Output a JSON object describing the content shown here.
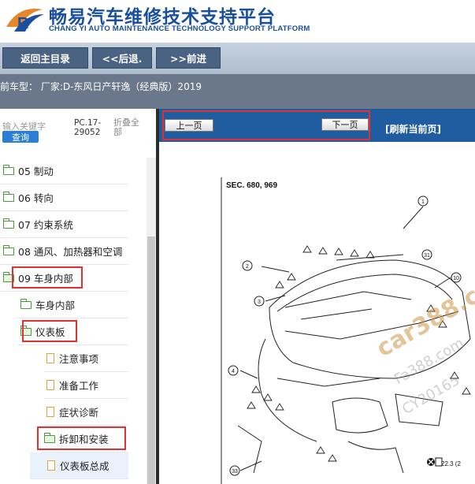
{
  "header": {
    "brand_cn": "畅易汽车维修技术支持平台",
    "brand_en": "CHANG YI AUTO MAINTENANCE TECHNOLOGY SUPPORT PLATFORM"
  },
  "nav": {
    "home": "返回主目录",
    "back": "<<后退.",
    "forward": ">>前进"
  },
  "model_bar": {
    "text": "前车型：  厂家:D-东风日产轩逸（经典版）2019"
  },
  "left_panel": {
    "keyword_label": "输入关键字",
    "query_button": "查询",
    "pc_number": "PC.17-29052",
    "collapse_all": "折叠全部"
  },
  "tree": {
    "items": [
      {
        "label": "05 制动"
      },
      {
        "label": "06 转向"
      },
      {
        "label": "07 约束系统"
      },
      {
        "label": "08 通风、加热器和空调"
      },
      {
        "label": "09 车身内部"
      },
      {
        "label": "车身内部"
      },
      {
        "label": "仪表板"
      },
      {
        "label": "注意事项"
      },
      {
        "label": "准备工作"
      },
      {
        "label": "症状诊断"
      },
      {
        "label": "拆卸和安装"
      },
      {
        "label": "仪表板总成"
      }
    ]
  },
  "right_panel": {
    "prev_page": "上一页",
    "next_page": "下一页",
    "refresh": "[刷新当前页]",
    "section_label": "SEC. 680, 969",
    "page_ref": "22.3 (2",
    "callouts": [
      "1",
      "2",
      "3",
      "4",
      "10",
      "31",
      "33"
    ]
  },
  "watermark": {
    "main": "car388.com",
    "line2": "Fa388.com",
    "line3": "CY20165"
  },
  "colors": {
    "brand_blue": "#1a4f9e",
    "nav_button": "#4a6383",
    "toolbar_blue": "#1f5da0",
    "highlight_red": "#e03030",
    "folder_green": "#4a9a3a",
    "doc_orange": "#e2a13a"
  }
}
